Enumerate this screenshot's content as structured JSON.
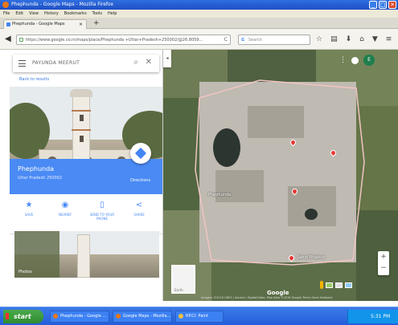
{
  "window": {
    "title": "Phephunda - Google Maps - Mozilla Firefox"
  },
  "menu": [
    "File",
    "Edit",
    "View",
    "History",
    "Bookmarks",
    "Tools",
    "Help"
  ],
  "tab": {
    "label": "Phephunda - Google Maps"
  },
  "url": {
    "value": "https://www.google.co.in/maps/place/Phephunda +Uttar+Pradesh+250002/@26.8059... "
  },
  "search_bar": {
    "placeholder": "Search"
  },
  "panel": {
    "search_query": "PAYUNDA MEERUT",
    "back_link": "Back to results",
    "place_name": "Phephunda",
    "place_sub": "Uttar Pradesh 250002",
    "directions_label": "Directions",
    "actions": [
      {
        "label": "SAVE",
        "icon": "star-icon"
      },
      {
        "label": "NEARBY",
        "icon": "nearby-icon"
      },
      {
        "label": "SEND TO YOUR PHONE",
        "icon": "phone-icon"
      },
      {
        "label": "SHARE",
        "icon": "share-icon"
      }
    ],
    "photos_label": "Photos"
  },
  "map": {
    "labels": [
      "Phephunda",
      "Sahid Bhaktur"
    ],
    "account_initial": "E",
    "satellite_label": "Earth",
    "brand": "Google",
    "attribution": "Imagery ©2016 CNES / Astrium, DigitalGlobe, Map data ©2016 Google   Terms   Send feedback"
  },
  "taskbar": {
    "start": "start",
    "items": [
      "Phephunda - Google ...",
      "Google Maps - Mozilla...",
      "RP.CI: Paint"
    ],
    "time": "5:31 PM"
  },
  "colors": {
    "accent": "#4a8af4",
    "title_bar": "#2f6ee0",
    "taskbar": "#245edb",
    "pin": "#e53935"
  }
}
